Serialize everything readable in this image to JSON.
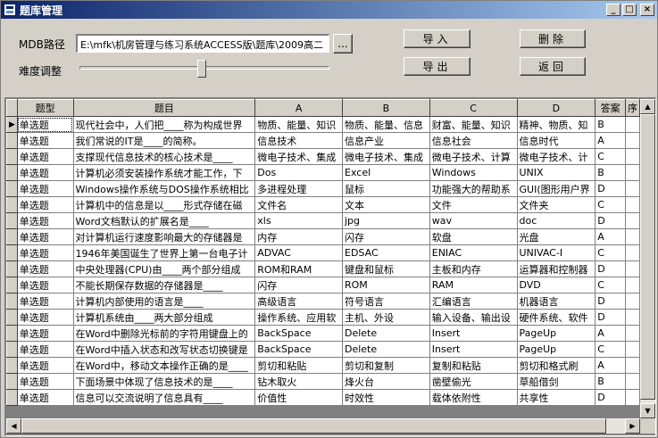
{
  "window": {
    "title": "题库管理"
  },
  "form": {
    "mdb_label": "MDB路径",
    "mdb_path": "E:\\mfk\\机房管理与练习系统ACCESS版\\题库\\2009高二",
    "browse_label": "...",
    "difficulty_label": "难度调整",
    "difficulty_level": 0.5
  },
  "buttons": {
    "import": "导入",
    "delete": "删除",
    "export": "导出",
    "back": "返回"
  },
  "grid": {
    "columns": [
      "题型",
      "题目",
      "A",
      "B",
      "C",
      "D",
      "答案",
      "序"
    ],
    "rows": [
      [
        "单选题",
        "现代社会中，人们把____称为构成世界",
        "物质、能量、知识",
        "物质、能量、信息",
        "财富、能量、知识",
        "精神、物质、知",
        "B"
      ],
      [
        "单选题",
        "我们常说的IT是____的简称。",
        "信息技术",
        "信息产业",
        "信息社会",
        "信息时代",
        "A"
      ],
      [
        "单选题",
        "支撑现代信息技术的核心技术是____",
        "微电子技术、集成",
        "微电子技术、集成",
        "微电子技术、计算",
        "微电子技术、计",
        "C"
      ],
      [
        "单选题",
        "计算机必须安装操作系统才能工作，下",
        "Dos",
        "Excel",
        "Windows",
        "UNIX",
        "B"
      ],
      [
        "单选题",
        "Windows操作系统与DOS操作系统相比",
        "多进程处理",
        "鼠标",
        "功能强大的帮助系",
        "GUI(图形用户界",
        "D"
      ],
      [
        "单选题",
        "计算机中的信息是以____形式存储在磁",
        "文件名",
        "文本",
        "文件",
        "文件夹",
        "C"
      ],
      [
        "单选题",
        "Word文档默认的扩展名是____",
        "xls",
        "jpg",
        "wav",
        "doc",
        "D"
      ],
      [
        "单选题",
        "对计算机运行速度影响最大的存储器是",
        "内存",
        "闪存",
        "软盘",
        "光盘",
        "A"
      ],
      [
        "单选题",
        "1946年美国诞生了世界上第一台电子计",
        "ADVAC",
        "EDSAC",
        "ENIAC",
        "UNIVAC-I",
        "C"
      ],
      [
        "单选题",
        "中央处理器(CPU)由____两个部分组成",
        "ROM和RAM",
        "键盘和鼠标",
        "主板和内存",
        "运算器和控制器",
        "D"
      ],
      [
        "单选题",
        "不能长期保存数据的存储器是____",
        "闪存",
        "ROM",
        "RAM",
        "DVD",
        "C"
      ],
      [
        "单选题",
        "计算机内部使用的语言是____",
        "高级语言",
        "符号语言",
        "汇编语言",
        "机器语言",
        "D"
      ],
      [
        "单选题",
        "计算机系统由____两大部分组成",
        "操作系统、应用软",
        "主机、外设",
        "输入设备、输出设",
        "硬件系统、软件",
        "D"
      ],
      [
        "单选题",
        "在Word中删除光标前的字符用键盘上的",
        "BackSpace",
        "Delete",
        "Insert",
        "PageUp",
        "A"
      ],
      [
        "单选题",
        "在Word中插入状态和改写状态切换键是",
        "BackSpace",
        "Delete",
        "Insert",
        "PageUp",
        "C"
      ],
      [
        "单选题",
        "在Word中，移动文本操作正确的是____",
        "剪切和粘贴",
        "剪切和复制",
        "复制和粘贴",
        "剪切和格式刷",
        "A"
      ],
      [
        "单选题",
        "下面场景中体现了信息技术的是____",
        "钻木取火",
        "烽火台",
        "凿壁偷光",
        "草船借剑",
        "B"
      ],
      [
        "单选题",
        "信息可以交流说明了信息具有____",
        "价值性",
        "时效性",
        "载体依附性",
        "共享性",
        "D"
      ]
    ]
  }
}
